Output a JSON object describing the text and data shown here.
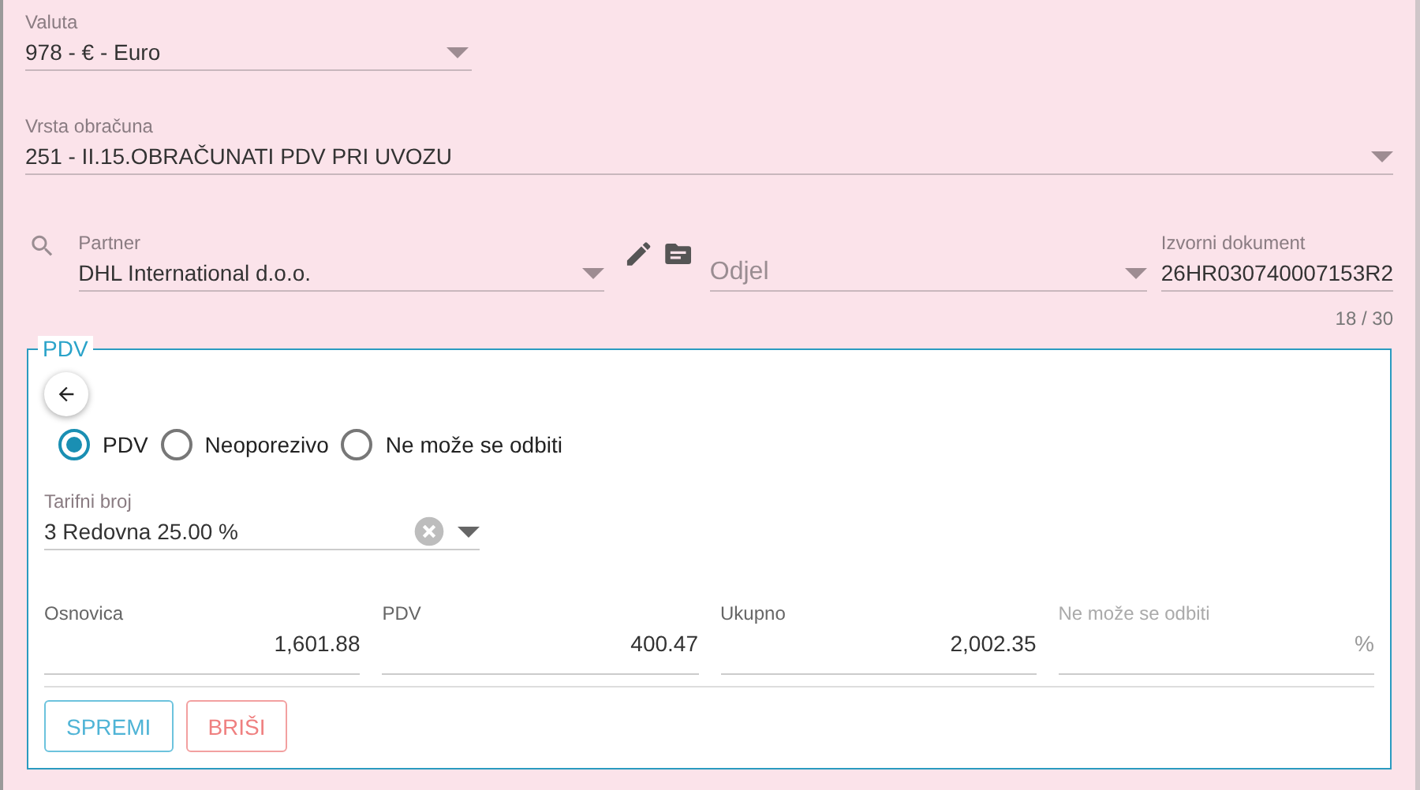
{
  "valuta": {
    "label": "Valuta",
    "value": "978 - € - Euro"
  },
  "vrsta_obracuna": {
    "label": "Vrsta obračuna",
    "value": "251 - II.15.OBRAČUNATI PDV PRI UVOZU"
  },
  "partner": {
    "label": "Partner",
    "value": "DHL International d.o.o."
  },
  "odjel": {
    "placeholder": "Odjel"
  },
  "izvorni_dokument": {
    "label": "Izvorni dokument",
    "value": "26HR030740007153R2",
    "counter": "18 / 30"
  },
  "pdv_panel": {
    "legend": "PDV",
    "radios": [
      {
        "label": "PDV",
        "selected": true
      },
      {
        "label": "Neoporezivo",
        "selected": false
      },
      {
        "label": "Ne može se odbiti",
        "selected": false
      }
    ],
    "tarifni_broj": {
      "label": "Tarifni broj",
      "value": "3 Redovna 25.00 %"
    },
    "amounts": [
      {
        "label": "Osnovica",
        "value": "1,601.88",
        "disabled": false
      },
      {
        "label": "PDV",
        "value": "400.47",
        "disabled": false
      },
      {
        "label": "Ukupno",
        "value": "2,002.35",
        "disabled": false
      },
      {
        "label": "Ne može se odbiti",
        "suffix": "%",
        "disabled": true
      }
    ],
    "buttons": [
      {
        "label": "SPREMI",
        "kind": "primary"
      },
      {
        "label": "BRIŠI",
        "kind": "danger"
      }
    ]
  }
}
